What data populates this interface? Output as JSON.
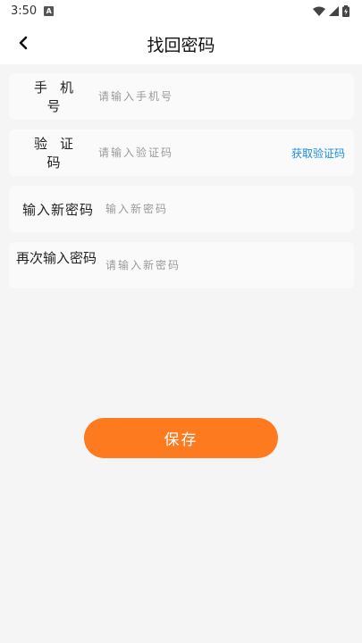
{
  "status_bar": {
    "time": "3:50",
    "notification_badge": "A",
    "icons": [
      "wifi-icon",
      "signal-icon",
      "battery-charging-icon"
    ]
  },
  "header": {
    "back_icon": "chevron-left-icon",
    "title": "找回密码"
  },
  "form": {
    "phone": {
      "label": "手机号",
      "placeholder": "请输入手机号"
    },
    "code": {
      "label": "验证码",
      "placeholder": "请输入验证码",
      "action": "获取验证码"
    },
    "new_password": {
      "label": "输入新密码",
      "placeholder": "输入新密码"
    },
    "confirm_password": {
      "label": "再次输入密码",
      "placeholder": "请输入新密码"
    }
  },
  "save_label": "保存",
  "colors": {
    "accent": "#fd7a1f",
    "link": "#1a8de0",
    "background": "#f5f5f5"
  }
}
